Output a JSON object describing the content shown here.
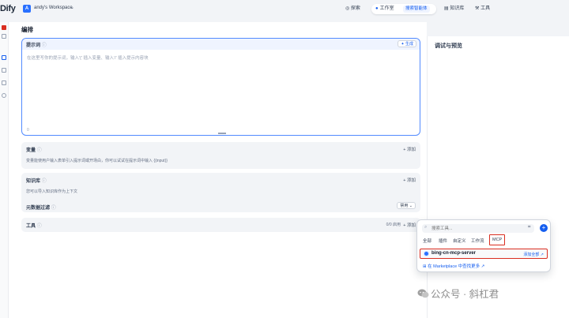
{
  "app": {
    "logo": "Dify"
  },
  "workspace": {
    "avatar_letter": "A",
    "name": "andy's Workspace",
    "chevron": "⌄"
  },
  "nav": {
    "explore": "探索",
    "studio": "工作室",
    "studio_sub": "搜索智能体",
    "knowledge": "知识库",
    "tools": "工具"
  },
  "main": {
    "title": "编排",
    "prompt": {
      "label": "提示词",
      "label_icon": "ⓘ",
      "generate_label": "生成",
      "placeholder": "在这里写你的提示词，输入'{' 插入变量、输入'/' 插入提示内容块",
      "char_count": "0"
    },
    "variables": {
      "title": "变量",
      "add_label": "添加",
      "description": "变量能使用户输入表单引入提示词或开场白，你可以试试在提示词中输入 {{input}}"
    },
    "knowledge": {
      "title": "知识库",
      "add_label": "添加",
      "description": "您可以导入知识库作为上下文",
      "metadata_filter": "元数据过滤",
      "metadata_button": "禁用"
    },
    "tools": {
      "title": "工具",
      "count": "0/0 启用",
      "add_label": "添加"
    }
  },
  "right_panel": {
    "title": "调试与预览"
  },
  "tool_popover": {
    "search_placeholder": "搜索工具...",
    "tabs": [
      "全部",
      "插件",
      "自定义",
      "工作流",
      "MCP"
    ],
    "server_name": "bing-cn-mcp-server",
    "server_add": "添加全部",
    "marketplace_link": "在 Marketplace 中查找更多"
  },
  "watermark": {
    "text": "公众号 · 斜杠君"
  },
  "colors": {
    "accent": "#155eef",
    "highlight_border": "#d92d20"
  }
}
